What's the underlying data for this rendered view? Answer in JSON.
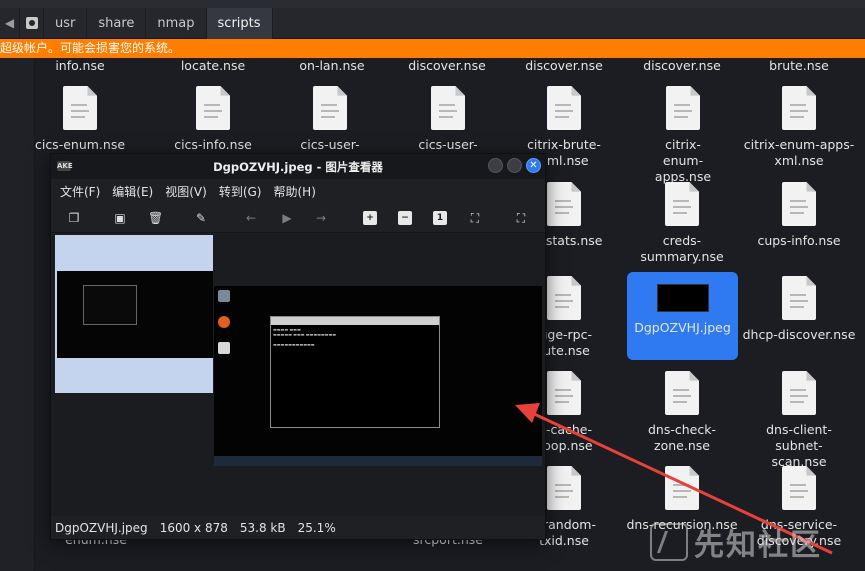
{
  "path_bar": {
    "crumbs": [
      "usr",
      "share",
      "nmap",
      "scripts"
    ]
  },
  "warning_text": "超级帐户。可能会损害您的系统。",
  "files": {
    "row0": [
      "info.nse",
      "locate.nse",
      "on-lan.nse",
      "discover.nse",
      "discover.nse",
      "discover.nse",
      "brute.nse"
    ],
    "row1": [
      "cics-enum.nse",
      "cics-info.nse",
      "cics-user-brute.nse",
      "cics-user-enum.nse",
      "citrix-brute-xml.nse",
      "citrix-enum-apps.nse",
      "citrix-enum-apps-xml.nse"
    ],
    "row2": [
      "db-stats.nse",
      "creds-summary.nse",
      "cups-info.nse"
    ],
    "row3": [
      "luge-rpc-rute.nse",
      "DgpOZVHJ.jpeg",
      "dhcp-discover.nse"
    ],
    "row4": [
      "is-cache-hoop.nse",
      "dns-check-zone.nse",
      "dns-client-subnet-scan.nse"
    ],
    "row5": [
      "s-random-txid.nse",
      "dns-recursion.nse",
      "dns-service-discovery.nse"
    ],
    "row5_cut": [
      "enum.nse",
      "srcport.nse"
    ]
  },
  "viewer": {
    "title": "DgpOZVHJ.jpeg - 图片查看器",
    "app_icon_label": "AKE",
    "menu": [
      "文件(F)",
      "编辑(E)",
      "视图(V)",
      "转到(G)",
      "帮助(H)"
    ],
    "status": {
      "filename": "DgpOZVHJ.jpeg",
      "dimensions": "1600 x 878",
      "size": "53.8 kB",
      "zoom": "25.1%"
    }
  },
  "watermark": "先知社区",
  "colors": {
    "accent_blue": "#2f7af0",
    "warning_orange": "#ff7d00",
    "arrow_red": "#e8413a"
  }
}
